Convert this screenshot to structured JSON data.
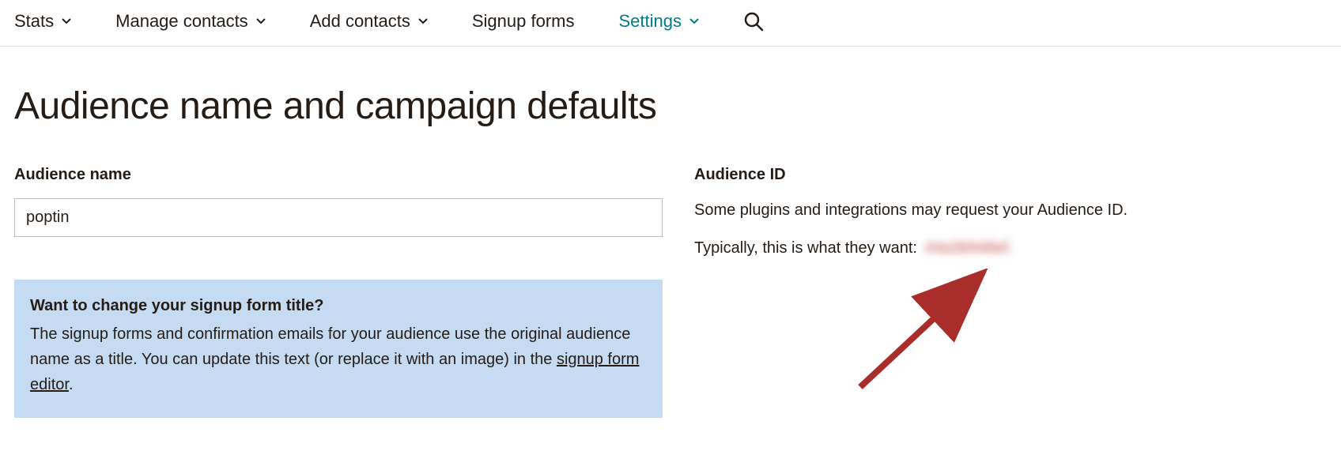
{
  "nav": {
    "items": [
      {
        "label": "Stats",
        "hasDropdown": true,
        "active": false
      },
      {
        "label": "Manage contacts",
        "hasDropdown": true,
        "active": false
      },
      {
        "label": "Add contacts",
        "hasDropdown": true,
        "active": false
      },
      {
        "label": "Signup forms",
        "hasDropdown": false,
        "active": false
      },
      {
        "label": "Settings",
        "hasDropdown": true,
        "active": true
      }
    ]
  },
  "page": {
    "title": "Audience name and campaign defaults"
  },
  "left": {
    "audienceNameLabel": "Audience name",
    "audienceNameValue": "poptin",
    "info": {
      "title": "Want to change your signup form title?",
      "bodyBefore": "The signup forms and confirmation emails for your audience use the original audience name as a title. You can update this text (or replace it with an image) in the ",
      "linkText": "signup form editor",
      "bodyAfter": "."
    }
  },
  "right": {
    "heading": "Audience ID",
    "line1": "Some plugins and integrations may request your Audience ID.",
    "line2Prefix": "Typically, this is what they want: ",
    "idValue": "44a36948ef."
  }
}
